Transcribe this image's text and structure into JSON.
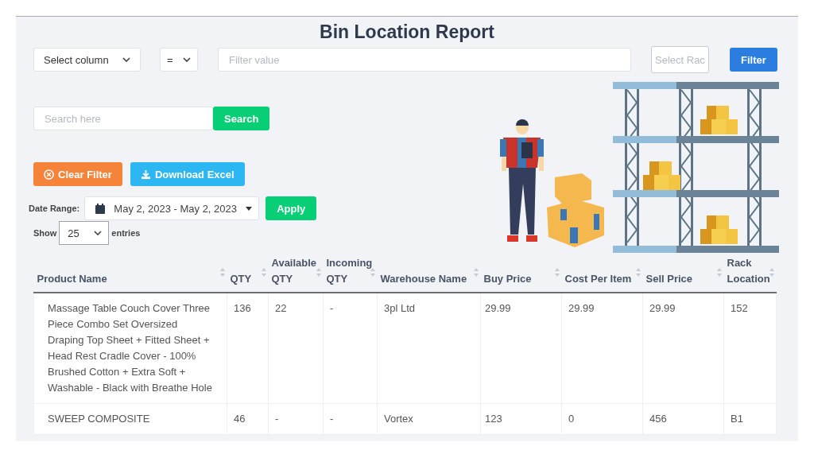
{
  "title": "Bin Location Report",
  "filter_bar": {
    "column_select": "Select column",
    "operator_select": "=",
    "filter_value": {
      "placeholder": "Filter value"
    },
    "rack_field": {
      "placeholder": "Select Rac"
    },
    "filter_button": "Filter"
  },
  "search": {
    "placeholder": "Search here",
    "button": "Search"
  },
  "actions": [
    {
      "kind": "clear",
      "label": "Clear Filter"
    },
    {
      "kind": "download",
      "label": "Download Excel"
    }
  ],
  "date_range": {
    "label": "Date Range:",
    "value": "May 2, 2023 - May 2, 2023",
    "apply": "Apply"
  },
  "entries": {
    "show": "Show",
    "value": "25",
    "suffix": "entries"
  },
  "table": {
    "columns": [
      "Product Name",
      "QTY",
      "Available QTY",
      "Incoming QTY",
      "Warehouse Name",
      "Buy Price",
      "Cost Per Item",
      "Sell Price",
      "Rack Location"
    ],
    "rows": [
      [
        "Massage Table Couch Cover Three Piece Combo Set Oversized Draping Top Sheet + Fitted Sheet + Head Rest Cradle Cover - 100% Brushed Cotton + Extra Soft + Washable - Black with Breathe Hole",
        "136",
        "22",
        "-",
        "3pl Ltd",
        "29.99",
        "29.99",
        "29.99",
        "152"
      ],
      [
        "SWEEP COMPOSITE",
        "46",
        "-",
        "-",
        "Vortex",
        "123",
        "0",
        "456",
        "B1"
      ]
    ]
  }
}
